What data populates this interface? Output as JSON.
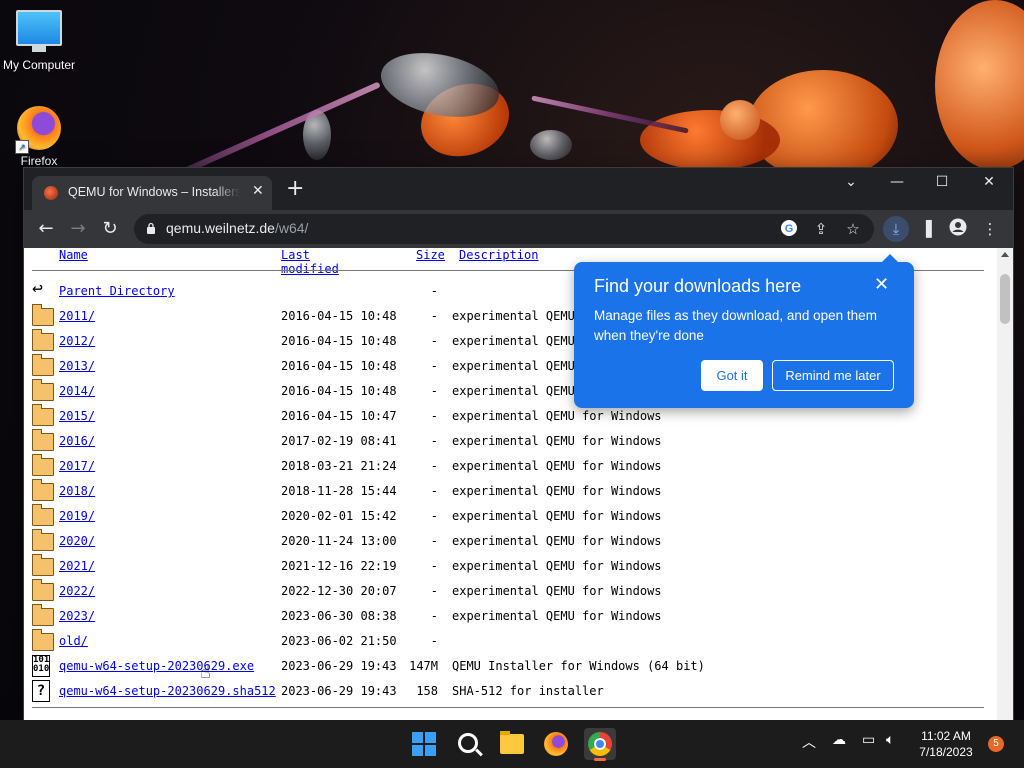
{
  "desktop": {
    "icons": [
      {
        "label": "My Computer"
      },
      {
        "label": "Firefox"
      }
    ]
  },
  "browser": {
    "tab_title": "QEMU for Windows – Installers (C",
    "tab_close": "✕",
    "new_tab": "+",
    "window_controls": {
      "tabsearch": "⌄",
      "minimize": "—",
      "maximize": "☐",
      "close": "✕"
    },
    "url_domain": "qemu.weilnetz.de",
    "url_path": "/w64/"
  },
  "listing": {
    "headers": {
      "name": "Name",
      "last_modified": "Last modified",
      "size": "Size",
      "description": "Description"
    },
    "rows": [
      {
        "icon": "back",
        "name": "Parent Directory",
        "date": "",
        "size": "-",
        "desc": ""
      },
      {
        "icon": "folder",
        "name": "2011/",
        "date": "2016-04-15 10:48",
        "size": "-",
        "desc": "experimental QEMU for Windows"
      },
      {
        "icon": "folder",
        "name": "2012/",
        "date": "2016-04-15 10:48",
        "size": "-",
        "desc": "experimental QEMU for Windows"
      },
      {
        "icon": "folder",
        "name": "2013/",
        "date": "2016-04-15 10:48",
        "size": "-",
        "desc": "experimental QEMU for Windows"
      },
      {
        "icon": "folder",
        "name": "2014/",
        "date": "2016-04-15 10:48",
        "size": "-",
        "desc": "experimental QEMU for Windows"
      },
      {
        "icon": "folder",
        "name": "2015/",
        "date": "2016-04-15 10:47",
        "size": "-",
        "desc": "experimental QEMU for Windows"
      },
      {
        "icon": "folder",
        "name": "2016/",
        "date": "2017-02-19 08:41",
        "size": "-",
        "desc": "experimental QEMU for Windows"
      },
      {
        "icon": "folder",
        "name": "2017/",
        "date": "2018-03-21 21:24",
        "size": "-",
        "desc": "experimental QEMU for Windows"
      },
      {
        "icon": "folder",
        "name": "2018/",
        "date": "2018-11-28 15:44",
        "size": "-",
        "desc": "experimental QEMU for Windows"
      },
      {
        "icon": "folder",
        "name": "2019/",
        "date": "2020-02-01 15:42",
        "size": "-",
        "desc": "experimental QEMU for Windows"
      },
      {
        "icon": "folder",
        "name": "2020/",
        "date": "2020-11-24 13:00",
        "size": "-",
        "desc": "experimental QEMU for Windows"
      },
      {
        "icon": "folder",
        "name": "2021/",
        "date": "2021-12-16 22:19",
        "size": "-",
        "desc": "experimental QEMU for Windows"
      },
      {
        "icon": "folder",
        "name": "2022/",
        "date": "2022-12-30 20:07",
        "size": "-",
        "desc": "experimental QEMU for Windows"
      },
      {
        "icon": "folder",
        "name": "2023/",
        "date": "2023-06-30 08:38",
        "size": "-",
        "desc": "experimental QEMU for Windows"
      },
      {
        "icon": "folder",
        "name": "old/",
        "date": "2023-06-02 21:50",
        "size": "-",
        "desc": ""
      },
      {
        "icon": "binary",
        "name": "qemu-w64-setup-20230629.exe",
        "date": "2023-06-29 19:43",
        "size": "147M",
        "desc": "QEMU Installer for Windows (64 bit)"
      },
      {
        "icon": "unknown",
        "name": "qemu-w64-setup-20230629.sha512",
        "date": "2023-06-29 19:43",
        "size": "158",
        "desc": "SHA-512 for installer"
      }
    ]
  },
  "bubble": {
    "title": "Find your downloads here",
    "body": "Manage files as they download, and open them when they're done",
    "close": "✕",
    "got_it": "Got it",
    "remind": "Remind me later",
    "color": "#1a73e8"
  },
  "taskbar": {
    "time": "11:02 AM",
    "date": "7/18/2023",
    "notifications": "5",
    "active_color": "#ff6a3a"
  }
}
